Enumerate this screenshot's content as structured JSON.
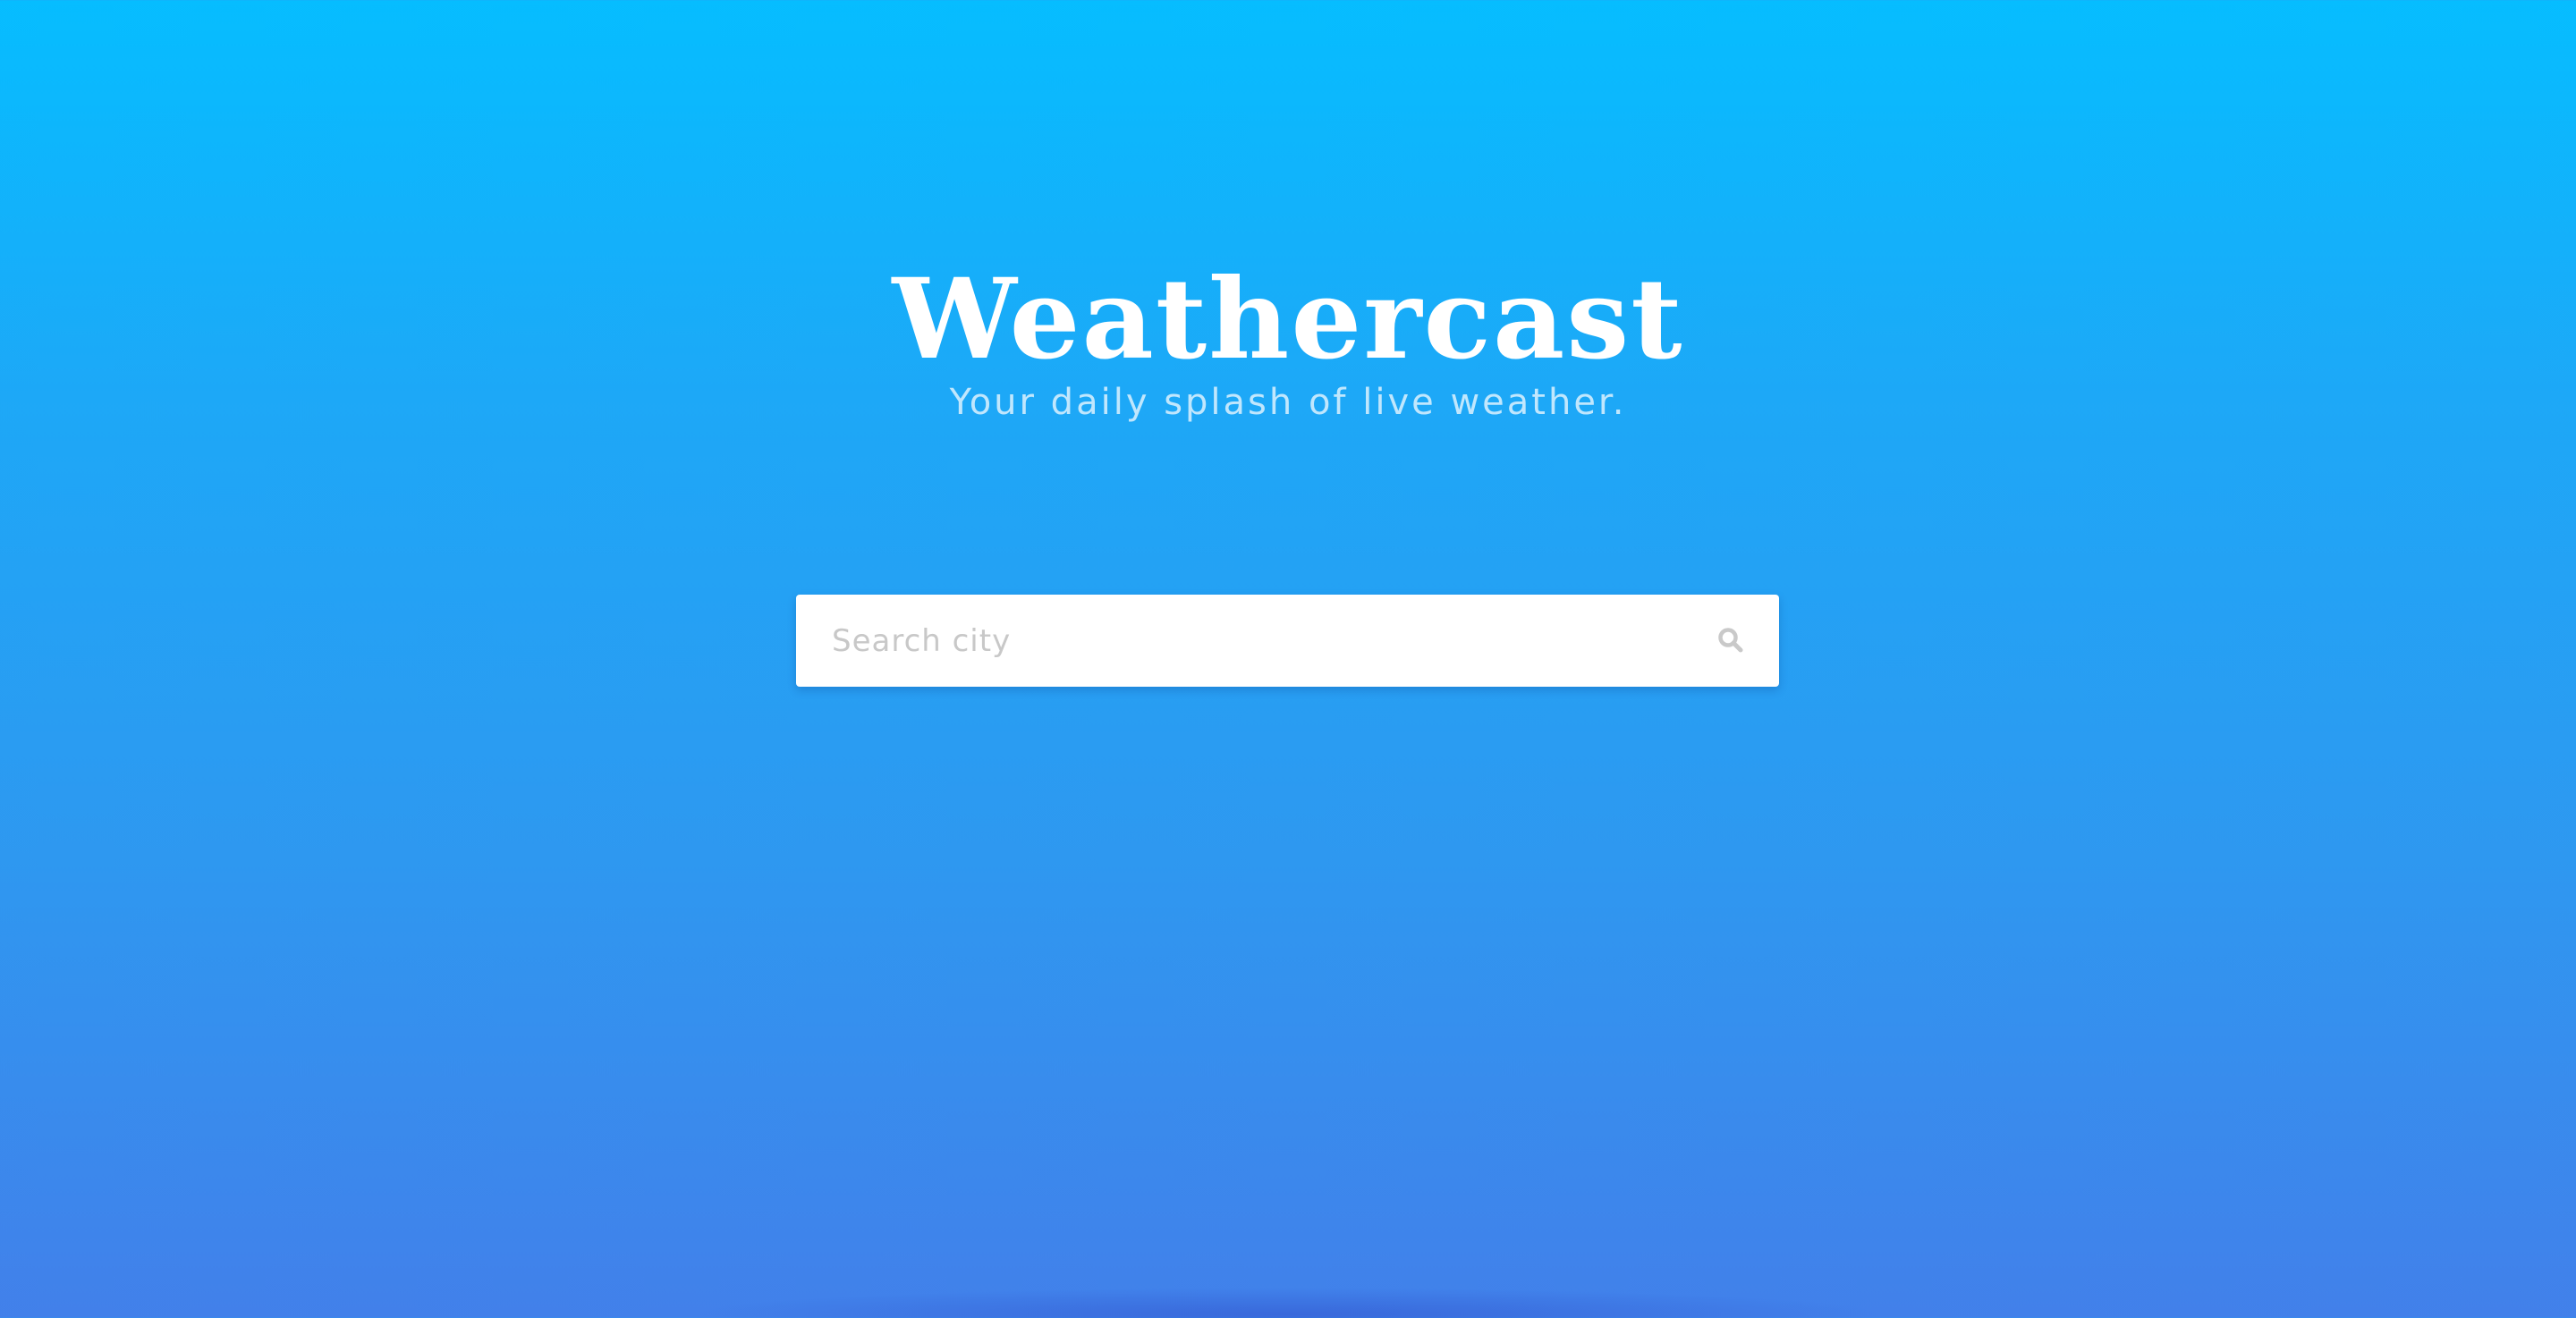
{
  "app": {
    "title": "Weathercast",
    "tagline": "Your daily splash of live weather."
  },
  "search": {
    "placeholder": "Search city",
    "value": "",
    "icon": "search-icon"
  },
  "colors": {
    "background_top": "#06bdff",
    "background_bottom": "#4280ea",
    "search_box": "#ffffff",
    "placeholder": "#c8c8c8",
    "icon": "#c9c9c9"
  }
}
